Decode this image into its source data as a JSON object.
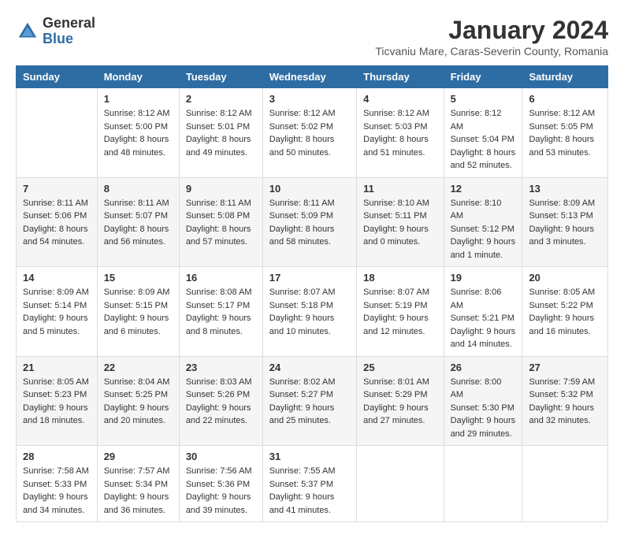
{
  "logo": {
    "general": "General",
    "blue": "Blue"
  },
  "title": {
    "month": "January 2024",
    "location": "Ticvaniu Mare, Caras-Severin County, Romania"
  },
  "weekdays": [
    "Sunday",
    "Monday",
    "Tuesday",
    "Wednesday",
    "Thursday",
    "Friday",
    "Saturday"
  ],
  "weeks": [
    [
      {
        "day": "",
        "sunrise": "",
        "sunset": "",
        "daylight": ""
      },
      {
        "day": "1",
        "sunrise": "Sunrise: 8:12 AM",
        "sunset": "Sunset: 5:00 PM",
        "daylight": "Daylight: 8 hours and 48 minutes."
      },
      {
        "day": "2",
        "sunrise": "Sunrise: 8:12 AM",
        "sunset": "Sunset: 5:01 PM",
        "daylight": "Daylight: 8 hours and 49 minutes."
      },
      {
        "day": "3",
        "sunrise": "Sunrise: 8:12 AM",
        "sunset": "Sunset: 5:02 PM",
        "daylight": "Daylight: 8 hours and 50 minutes."
      },
      {
        "day": "4",
        "sunrise": "Sunrise: 8:12 AM",
        "sunset": "Sunset: 5:03 PM",
        "daylight": "Daylight: 8 hours and 51 minutes."
      },
      {
        "day": "5",
        "sunrise": "Sunrise: 8:12 AM",
        "sunset": "Sunset: 5:04 PM",
        "daylight": "Daylight: 8 hours and 52 minutes."
      },
      {
        "day": "6",
        "sunrise": "Sunrise: 8:12 AM",
        "sunset": "Sunset: 5:05 PM",
        "daylight": "Daylight: 8 hours and 53 minutes."
      }
    ],
    [
      {
        "day": "7",
        "sunrise": "Sunrise: 8:11 AM",
        "sunset": "Sunset: 5:06 PM",
        "daylight": "Daylight: 8 hours and 54 minutes."
      },
      {
        "day": "8",
        "sunrise": "Sunrise: 8:11 AM",
        "sunset": "Sunset: 5:07 PM",
        "daylight": "Daylight: 8 hours and 56 minutes."
      },
      {
        "day": "9",
        "sunrise": "Sunrise: 8:11 AM",
        "sunset": "Sunset: 5:08 PM",
        "daylight": "Daylight: 8 hours and 57 minutes."
      },
      {
        "day": "10",
        "sunrise": "Sunrise: 8:11 AM",
        "sunset": "Sunset: 5:09 PM",
        "daylight": "Daylight: 8 hours and 58 minutes."
      },
      {
        "day": "11",
        "sunrise": "Sunrise: 8:10 AM",
        "sunset": "Sunset: 5:11 PM",
        "daylight": "Daylight: 9 hours and 0 minutes."
      },
      {
        "day": "12",
        "sunrise": "Sunrise: 8:10 AM",
        "sunset": "Sunset: 5:12 PM",
        "daylight": "Daylight: 9 hours and 1 minute."
      },
      {
        "day": "13",
        "sunrise": "Sunrise: 8:09 AM",
        "sunset": "Sunset: 5:13 PM",
        "daylight": "Daylight: 9 hours and 3 minutes."
      }
    ],
    [
      {
        "day": "14",
        "sunrise": "Sunrise: 8:09 AM",
        "sunset": "Sunset: 5:14 PM",
        "daylight": "Daylight: 9 hours and 5 minutes."
      },
      {
        "day": "15",
        "sunrise": "Sunrise: 8:09 AM",
        "sunset": "Sunset: 5:15 PM",
        "daylight": "Daylight: 9 hours and 6 minutes."
      },
      {
        "day": "16",
        "sunrise": "Sunrise: 8:08 AM",
        "sunset": "Sunset: 5:17 PM",
        "daylight": "Daylight: 9 hours and 8 minutes."
      },
      {
        "day": "17",
        "sunrise": "Sunrise: 8:07 AM",
        "sunset": "Sunset: 5:18 PM",
        "daylight": "Daylight: 9 hours and 10 minutes."
      },
      {
        "day": "18",
        "sunrise": "Sunrise: 8:07 AM",
        "sunset": "Sunset: 5:19 PM",
        "daylight": "Daylight: 9 hours and 12 minutes."
      },
      {
        "day": "19",
        "sunrise": "Sunrise: 8:06 AM",
        "sunset": "Sunset: 5:21 PM",
        "daylight": "Daylight: 9 hours and 14 minutes."
      },
      {
        "day": "20",
        "sunrise": "Sunrise: 8:05 AM",
        "sunset": "Sunset: 5:22 PM",
        "daylight": "Daylight: 9 hours and 16 minutes."
      }
    ],
    [
      {
        "day": "21",
        "sunrise": "Sunrise: 8:05 AM",
        "sunset": "Sunset: 5:23 PM",
        "daylight": "Daylight: 9 hours and 18 minutes."
      },
      {
        "day": "22",
        "sunrise": "Sunrise: 8:04 AM",
        "sunset": "Sunset: 5:25 PM",
        "daylight": "Daylight: 9 hours and 20 minutes."
      },
      {
        "day": "23",
        "sunrise": "Sunrise: 8:03 AM",
        "sunset": "Sunset: 5:26 PM",
        "daylight": "Daylight: 9 hours and 22 minutes."
      },
      {
        "day": "24",
        "sunrise": "Sunrise: 8:02 AM",
        "sunset": "Sunset: 5:27 PM",
        "daylight": "Daylight: 9 hours and 25 minutes."
      },
      {
        "day": "25",
        "sunrise": "Sunrise: 8:01 AM",
        "sunset": "Sunset: 5:29 PM",
        "daylight": "Daylight: 9 hours and 27 minutes."
      },
      {
        "day": "26",
        "sunrise": "Sunrise: 8:00 AM",
        "sunset": "Sunset: 5:30 PM",
        "daylight": "Daylight: 9 hours and 29 minutes."
      },
      {
        "day": "27",
        "sunrise": "Sunrise: 7:59 AM",
        "sunset": "Sunset: 5:32 PM",
        "daylight": "Daylight: 9 hours and 32 minutes."
      }
    ],
    [
      {
        "day": "28",
        "sunrise": "Sunrise: 7:58 AM",
        "sunset": "Sunset: 5:33 PM",
        "daylight": "Daylight: 9 hours and 34 minutes."
      },
      {
        "day": "29",
        "sunrise": "Sunrise: 7:57 AM",
        "sunset": "Sunset: 5:34 PM",
        "daylight": "Daylight: 9 hours and 36 minutes."
      },
      {
        "day": "30",
        "sunrise": "Sunrise: 7:56 AM",
        "sunset": "Sunset: 5:36 PM",
        "daylight": "Daylight: 9 hours and 39 minutes."
      },
      {
        "day": "31",
        "sunrise": "Sunrise: 7:55 AM",
        "sunset": "Sunset: 5:37 PM",
        "daylight": "Daylight: 9 hours and 41 minutes."
      },
      {
        "day": "",
        "sunrise": "",
        "sunset": "",
        "daylight": ""
      },
      {
        "day": "",
        "sunrise": "",
        "sunset": "",
        "daylight": ""
      },
      {
        "day": "",
        "sunrise": "",
        "sunset": "",
        "daylight": ""
      }
    ]
  ]
}
